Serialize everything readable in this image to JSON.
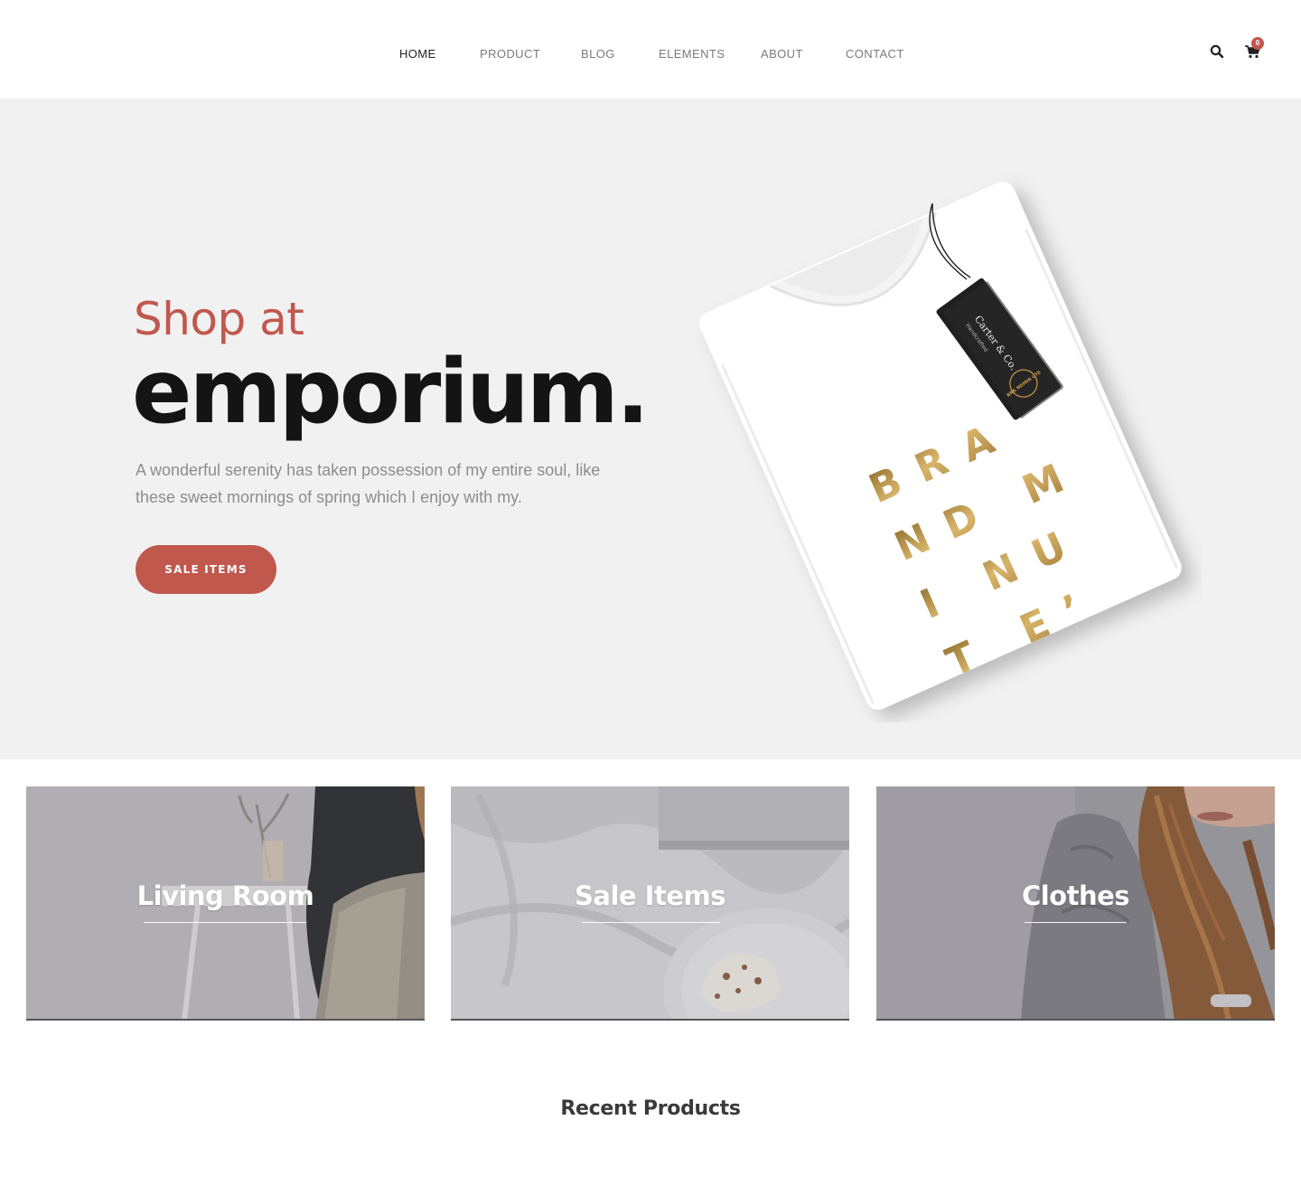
{
  "nav": {
    "items": [
      {
        "label": "HOME",
        "active": true
      },
      {
        "label": "PRODUCT",
        "active": false
      },
      {
        "label": "BLOG",
        "active": false
      },
      {
        "label": "ELEMENTS",
        "active": false
      },
      {
        "label": "ABOUT",
        "active": false
      },
      {
        "label": "CONTACT",
        "active": false
      }
    ],
    "search_icon": "search-icon",
    "cart_icon": "shopping-cart-icon",
    "cart_count": "0"
  },
  "hero": {
    "kicker": "Shop at",
    "title": "emporium.",
    "description": "A wonderful serenity has taken possession of my entire soul, like these sweet mornings of spring which I enjoy with my.",
    "button_label": "SALE ITEMS",
    "shirt_print_lines": [
      "BRA",
      "ND M",
      "I NU",
      "T E’"
    ],
    "tag_brand": "Carter & Co.",
    "tag_sub": "Handcrafted",
    "tag_logo": "BRA NDMIN UTE"
  },
  "categories": [
    {
      "label": "Living Room"
    },
    {
      "label": "Sale Items"
    },
    {
      "label": "Clothes"
    }
  ],
  "recent_products": {
    "title": "Recent Products"
  },
  "colors": {
    "accent": "#c0584e",
    "hero_bg": "#f2f1f1",
    "text_dark": "#141414",
    "text_muted": "#8d8d8d",
    "gold": "#b8923f"
  }
}
